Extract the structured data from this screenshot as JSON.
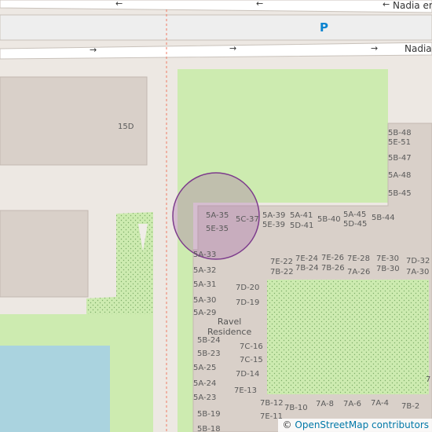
{
  "roads": {
    "top_name": "Nadia en",
    "second_name": "Nadia"
  },
  "parking_symbol": "P",
  "buildings": {
    "b15d": "15D",
    "units": [
      "5B-48",
      "5E-51",
      "5B-47",
      "5A-48",
      "5B-45",
      "5A-35",
      "5E-35",
      "5C-37",
      "5A-39",
      "5E-39",
      "5A-41",
      "5D-41",
      "5B-40",
      "5A-45",
      "5D-45",
      "5B-44",
      "5A-33",
      "5A-32",
      "5A-31",
      "5A-30",
      "5A-29",
      "7E-22",
      "7B-22",
      "7E-24",
      "7B-24",
      "7E-26",
      "7B-26",
      "7E-28",
      "7A-26",
      "7E-30",
      "7B-30",
      "7D-32",
      "7A-30",
      "7D-20",
      "7D-19",
      "5B-24",
      "5B-23",
      "5A-25",
      "5A-24",
      "5A-23",
      "5B-19",
      "5B-18",
      "7C-16",
      "7C-15",
      "7D-14",
      "7E-13",
      "7B-12",
      "7E-11",
      "7B-10",
      "7A-8",
      "7A-6",
      "7A-4",
      "7B-2",
      "7"
    ]
  },
  "place_name_line1": "Ravel",
  "place_name_line2": "Residence",
  "attribution": {
    "symbol": "©",
    "link_text": "OpenStreetMap contributors"
  },
  "colors": {
    "background": "#ede8e3",
    "building": "#d9d0c9",
    "park": "#cdebb0",
    "water": "#aad3df",
    "road": "#ffffff",
    "boundary": "#f07b64",
    "circle_stroke": "#7d3c8c"
  }
}
